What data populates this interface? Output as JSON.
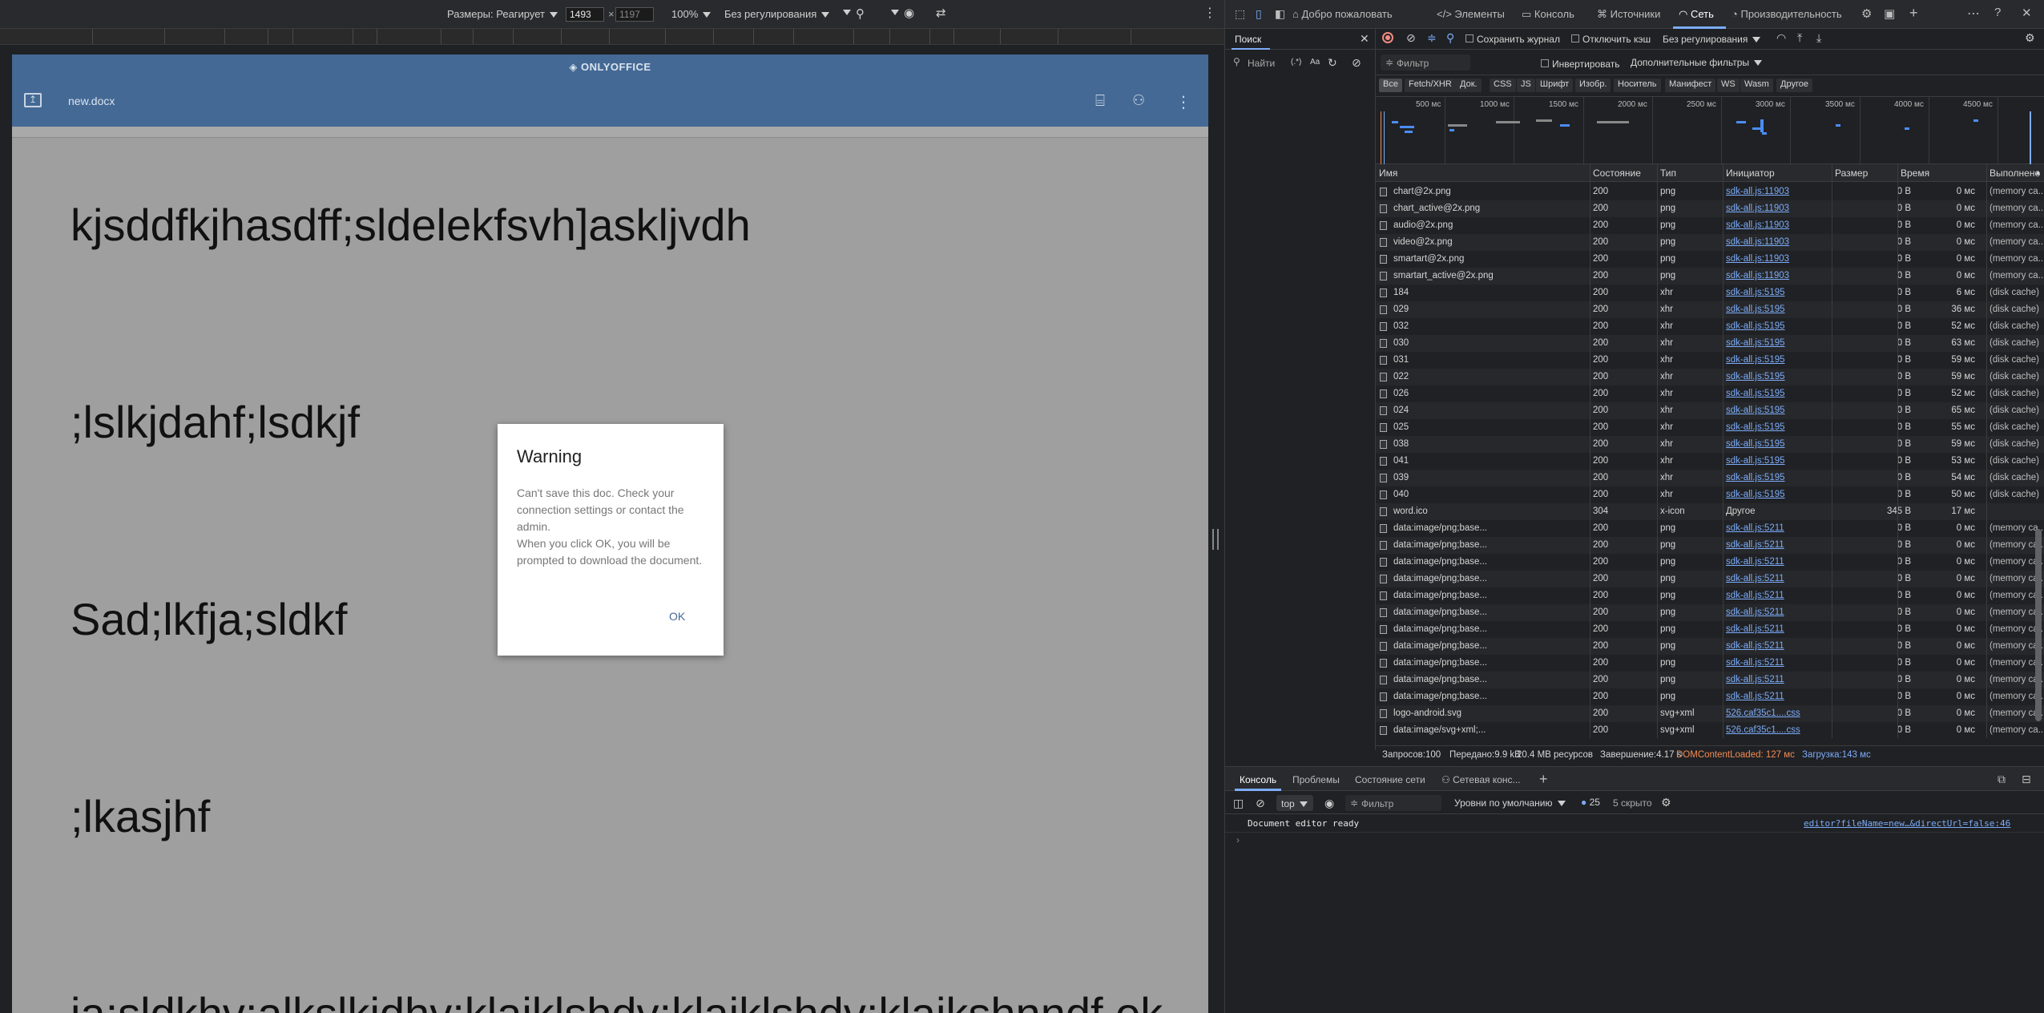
{
  "device_toolbar": {
    "dimensions_label": "Размеры: Реагирует",
    "width": "1493",
    "height": "1197",
    "zoom": "100%",
    "throttling": "Без регулирования"
  },
  "onlyoffice": {
    "logo": "ONLYOFFICE",
    "doc_name": "new.docx",
    "paragraphs": [
      "kjsddfkjhasdff;sldelekfsvh]askljvdh",
      ";lslkjdahf;lsdkjf",
      "Sad;lkfja;sldkf",
      ";lkasjhf",
      "ja;sldkhv;alkslkjdhv;klajklshdv;klajklshdv;klajkshnndf ok"
    ]
  },
  "warning_dialog": {
    "title": "Warning",
    "text1": "Can't save this doc. Check your connection settings or contact the admin.",
    "text2": "When you click OK, you will be prompted to download the document.",
    "ok_label": "OK"
  },
  "devtools": {
    "tabs": [
      "Добро пожаловать",
      "Элементы",
      "Консоль",
      "Источники",
      "Сеть",
      "Производительность"
    ],
    "search_panel": {
      "title": "Поиск",
      "find_placeholder": "Найти",
      "regex_label": "(.*)",
      "case_label": "Aa"
    },
    "network_bar": {
      "preserve_log": "Сохранить журнал",
      "disable_cache": "Отключить кэш",
      "throttling": "Без регулирования"
    },
    "filter_bar": {
      "filter_placeholder": "Фильтр",
      "invert": "Инвертировать",
      "more_filters": "Дополнительные фильтры"
    },
    "type_filters": [
      "Все",
      "Fetch/XHR",
      "Док.",
      "CSS",
      "JS",
      "Шрифт",
      "Изобр.",
      "Носитель",
      "Манифест",
      "WS",
      "Wasm",
      "Другое"
    ],
    "timeline_labels": [
      "500 мс",
      "1000 мс",
      "1500 мс",
      "2000 мс",
      "2500 мс",
      "3000 мс",
      "3500 мс",
      "4000 мс",
      "4500 мс"
    ],
    "columns": [
      "Имя",
      "Состояние",
      "Тип",
      "Инициатор",
      "Размер",
      "Время",
      "Выполнено"
    ],
    "rows": [
      [
        "chart@2x.png",
        "200",
        "png",
        "sdk-all.js:11903",
        "0 B",
        "0 мс",
        "(memory ca..."
      ],
      [
        "chart_active@2x.png",
        "200",
        "png",
        "sdk-all.js:11903",
        "0 B",
        "0 мс",
        "(memory ca..."
      ],
      [
        "audio@2x.png",
        "200",
        "png",
        "sdk-all.js:11903",
        "0 B",
        "0 мс",
        "(memory ca..."
      ],
      [
        "video@2x.png",
        "200",
        "png",
        "sdk-all.js:11903",
        "0 B",
        "0 мс",
        "(memory ca..."
      ],
      [
        "smartart@2x.png",
        "200",
        "png",
        "sdk-all.js:11903",
        "0 B",
        "0 мс",
        "(memory ca..."
      ],
      [
        "smartart_active@2x.png",
        "200",
        "png",
        "sdk-all.js:11903",
        "0 B",
        "0 мс",
        "(memory ca..."
      ],
      [
        "184",
        "200",
        "xhr",
        "sdk-all.js:5195",
        "0 B",
        "6 мс",
        "(disk cache)"
      ],
      [
        "029",
        "200",
        "xhr",
        "sdk-all.js:5195",
        "0 B",
        "36 мс",
        "(disk cache)"
      ],
      [
        "032",
        "200",
        "xhr",
        "sdk-all.js:5195",
        "0 B",
        "52 мс",
        "(disk cache)"
      ],
      [
        "030",
        "200",
        "xhr",
        "sdk-all.js:5195",
        "0 B",
        "63 мс",
        "(disk cache)"
      ],
      [
        "031",
        "200",
        "xhr",
        "sdk-all.js:5195",
        "0 B",
        "59 мс",
        "(disk cache)"
      ],
      [
        "022",
        "200",
        "xhr",
        "sdk-all.js:5195",
        "0 B",
        "59 мс",
        "(disk cache)"
      ],
      [
        "026",
        "200",
        "xhr",
        "sdk-all.js:5195",
        "0 B",
        "52 мс",
        "(disk cache)"
      ],
      [
        "024",
        "200",
        "xhr",
        "sdk-all.js:5195",
        "0 B",
        "65 мс",
        "(disk cache)"
      ],
      [
        "025",
        "200",
        "xhr",
        "sdk-all.js:5195",
        "0 B",
        "55 мс",
        "(disk cache)"
      ],
      [
        "038",
        "200",
        "xhr",
        "sdk-all.js:5195",
        "0 B",
        "59 мс",
        "(disk cache)"
      ],
      [
        "041",
        "200",
        "xhr",
        "sdk-all.js:5195",
        "0 B",
        "53 мс",
        "(disk cache)"
      ],
      [
        "039",
        "200",
        "xhr",
        "sdk-all.js:5195",
        "0 B",
        "54 мс",
        "(disk cache)"
      ],
      [
        "040",
        "200",
        "xhr",
        "sdk-all.js:5195",
        "0 B",
        "50 мс",
        "(disk cache)"
      ],
      [
        "word.ico",
        "304",
        "x-icon",
        "Другое",
        "345 B",
        "17 мс",
        ""
      ],
      [
        "data:image/png;base...",
        "200",
        "png",
        "sdk-all.js:5211",
        "0 B",
        "0 мс",
        "(memory ca..."
      ],
      [
        "data:image/png;base...",
        "200",
        "png",
        "sdk-all.js:5211",
        "0 B",
        "0 мс",
        "(memory ca..."
      ],
      [
        "data:image/png;base...",
        "200",
        "png",
        "sdk-all.js:5211",
        "0 B",
        "0 мс",
        "(memory ca..."
      ],
      [
        "data:image/png;base...",
        "200",
        "png",
        "sdk-all.js:5211",
        "0 B",
        "0 мс",
        "(memory ca..."
      ],
      [
        "data:image/png;base...",
        "200",
        "png",
        "sdk-all.js:5211",
        "0 B",
        "0 мс",
        "(memory ca..."
      ],
      [
        "data:image/png;base...",
        "200",
        "png",
        "sdk-all.js:5211",
        "0 B",
        "0 мс",
        "(memory ca..."
      ],
      [
        "data:image/png;base...",
        "200",
        "png",
        "sdk-all.js:5211",
        "0 B",
        "0 мс",
        "(memory ca..."
      ],
      [
        "data:image/png;base...",
        "200",
        "png",
        "sdk-all.js:5211",
        "0 B",
        "0 мс",
        "(memory ca..."
      ],
      [
        "data:image/png;base...",
        "200",
        "png",
        "sdk-all.js:5211",
        "0 B",
        "0 мс",
        "(memory ca..."
      ],
      [
        "data:image/png;base...",
        "200",
        "png",
        "sdk-all.js:5211",
        "0 B",
        "0 мс",
        "(memory ca..."
      ],
      [
        "data:image/png;base...",
        "200",
        "png",
        "sdk-all.js:5211",
        "0 B",
        "0 мс",
        "(memory ca..."
      ],
      [
        "logo-android.svg",
        "200",
        "svg+xml",
        "526.caf35c1....css",
        "0 B",
        "0 мс",
        "(memory ca..."
      ],
      [
        "data:image/svg+xml;...",
        "200",
        "svg+xml",
        "526.caf35c1....css",
        "0 B",
        "0 мс",
        "(memory ca..."
      ]
    ],
    "summary": {
      "requests": "Запросов:100",
      "transferred": "Передано:9.9 kB",
      "resources": "20.4 MB ресурсов",
      "finish": "Завершение:4.17 s",
      "dcl": "DOMContentLoaded: 127 мс",
      "load": "Загрузка:143 мс"
    },
    "drawer_tabs": [
      "Консоль",
      "Проблемы",
      "Состояние сети",
      "Сетевая конс..."
    ],
    "console_bar": {
      "context": "top",
      "filter_placeholder": "Фильтр",
      "levels": "Уровни по умолчанию",
      "issues_count": "25",
      "hidden": "5 скрыто"
    },
    "console_messages": [
      {
        "text": "Document editor ready",
        "source": "editor?fileName=new…&directUrl=false:46"
      }
    ]
  },
  "colors": {
    "onlyoffice_header": "#446995",
    "link": "#7cacf8",
    "dcl": "#f28b54",
    "load": "#7cacf8"
  }
}
